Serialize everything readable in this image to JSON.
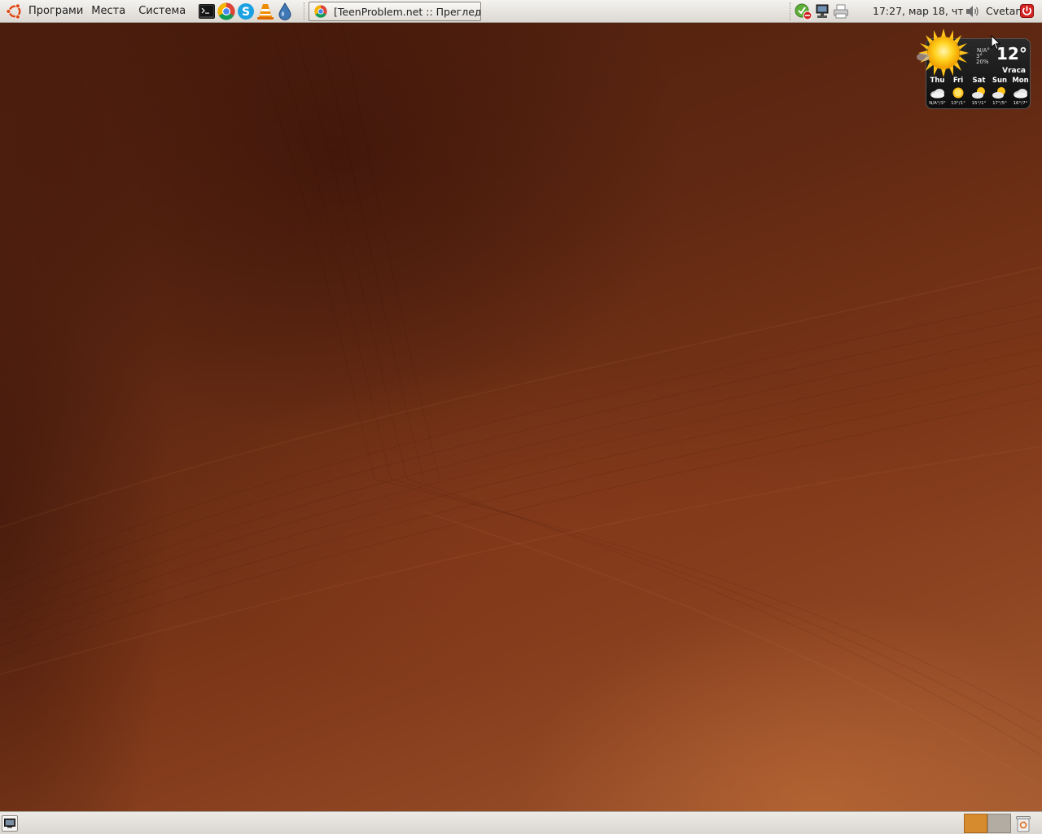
{
  "top_panel": {
    "menus": {
      "applications": "Програми",
      "places": "Места",
      "system": "Система"
    },
    "launchers": [
      "terminal-icon",
      "chrome-icon",
      "skype-icon",
      "vlc-icon",
      "water-drop-icon"
    ],
    "window_task": {
      "title": "[TeenProblem.net :: Прeглед...",
      "icon": "chrome-icon"
    },
    "tray_icons": [
      "update-notifier-icon",
      "network-icon",
      "printer-icon"
    ],
    "clock": "17:27, мар 18, чт",
    "user": "Cvetan"
  },
  "weather_widget": {
    "current_temp": "12°",
    "city": "Vraca",
    "current_na": "N/A°",
    "current_low": "3°",
    "humidity": "20%",
    "forecast": [
      {
        "day": "Thu",
        "temp": "N/A°/3°",
        "icon": "cloudy-icon"
      },
      {
        "day": "Fri",
        "temp": "13°/1°",
        "icon": "sun-icon"
      },
      {
        "day": "Sat",
        "temp": "15°/1°",
        "icon": "partly-cloudy-icon"
      },
      {
        "day": "Sun",
        "temp": "17°/5°",
        "icon": "partly-cloudy-icon"
      },
      {
        "day": "Mon",
        "temp": "16°/7°",
        "icon": "cloudy-icon"
      }
    ]
  },
  "colors": {
    "wallpaper_dark": "#4a1d0d",
    "wallpaper_light": "#a35a30",
    "workspace_active": "#d68b2e",
    "workspace_inactive": "#b3aca3"
  }
}
